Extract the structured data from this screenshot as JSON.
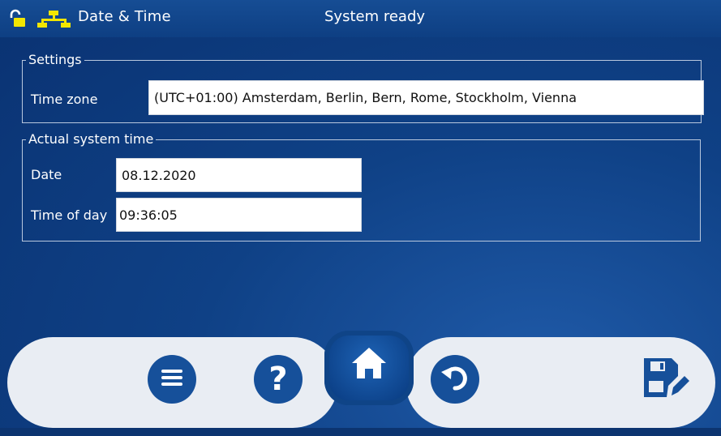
{
  "header": {
    "title": "Date & Time",
    "status": "System ready"
  },
  "settings": {
    "legend": "Settings",
    "time_zone_label": "Time zone",
    "time_zone_value": "(UTC+01:00) Amsterdam, Berlin, Bern, Rome, Stockholm, Vienna"
  },
  "actual_time": {
    "legend": "Actual system time",
    "date_label": "Date",
    "date_value": "08.12.2020",
    "time_label": "Time of day",
    "time_value": "09:36:05"
  },
  "nav": {
    "buttons": [
      "menu-icon",
      "help-icon",
      "home-icon",
      "undo-icon",
      "save-icon"
    ]
  },
  "colors": {
    "background": "#0f4186",
    "accent_yellow": "#f2e600",
    "nav_bar": "#e9edf3",
    "button_blue": "#16509a"
  }
}
